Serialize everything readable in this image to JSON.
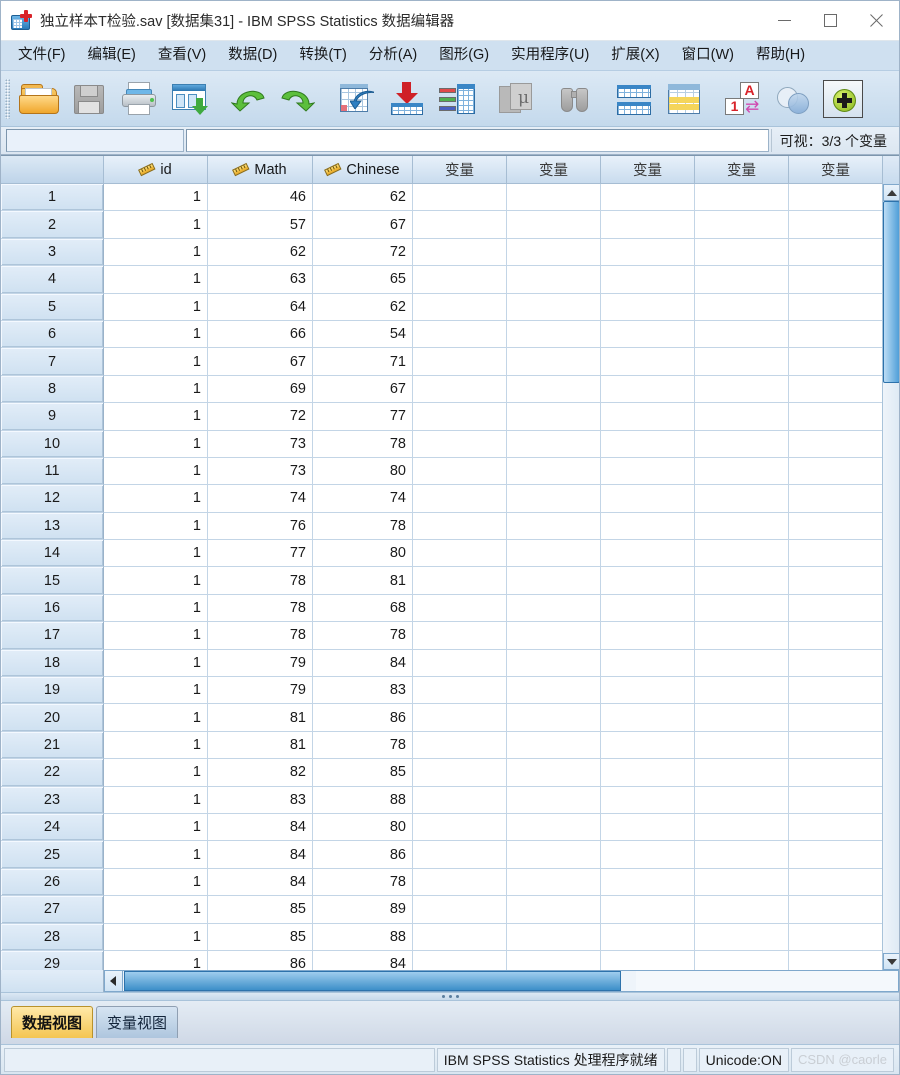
{
  "window": {
    "title": "独立样本T检验.sav [数据集31] - IBM SPSS Statistics 数据编辑器",
    "icon": "spss-data-editor-icon",
    "minimize_label": "—",
    "maximize_label": "□",
    "close_label": "✕"
  },
  "menu": [
    {
      "label": "文件(F)",
      "name": "menu-file"
    },
    {
      "label": "编辑(E)",
      "name": "menu-edit"
    },
    {
      "label": "查看(V)",
      "name": "menu-view"
    },
    {
      "label": "数据(D)",
      "name": "menu-data"
    },
    {
      "label": "转换(T)",
      "name": "menu-transform"
    },
    {
      "label": "分析(A)",
      "name": "menu-analyze"
    },
    {
      "label": "图形(G)",
      "name": "menu-graphs"
    },
    {
      "label": "实用程序(U)",
      "name": "menu-utilities"
    },
    {
      "label": "扩展(X)",
      "name": "menu-extensions"
    },
    {
      "label": "窗口(W)",
      "name": "menu-window"
    },
    {
      "label": "帮助(H)",
      "name": "menu-help"
    }
  ],
  "toolbar": [
    {
      "name": "open-file-icon"
    },
    {
      "name": "save-file-icon"
    },
    {
      "name": "print-icon"
    },
    {
      "name": "recall-dialogs-icon"
    },
    {
      "name": "undo-icon"
    },
    {
      "name": "redo-icon"
    },
    {
      "name": "goto-case-icon"
    },
    {
      "name": "goto-variable-icon"
    },
    {
      "name": "variables-icon"
    },
    {
      "name": "descriptive-statistics-icon"
    },
    {
      "name": "find-icon"
    },
    {
      "name": "split-file-icon"
    },
    {
      "name": "weight-cases-icon"
    },
    {
      "name": "value-labels-icon"
    },
    {
      "name": "use-subsets-icon"
    },
    {
      "name": "add-extension-icon"
    }
  ],
  "cellbar": {
    "cell_reference": "",
    "cell_value": "",
    "visible_vars": "可视：3/3 个变量"
  },
  "grid": {
    "columns": [
      {
        "label": "id",
        "measure_icon": "scale-ruler-icon",
        "named": true
      },
      {
        "label": "Math",
        "measure_icon": "scale-ruler-icon",
        "named": true
      },
      {
        "label": "Chinese",
        "measure_icon": "scale-ruler-icon",
        "named": true
      },
      {
        "label": "变量",
        "named": false
      },
      {
        "label": "变量",
        "named": false
      },
      {
        "label": "变量",
        "named": false
      },
      {
        "label": "变量",
        "named": false
      },
      {
        "label": "变量",
        "named": false
      }
    ],
    "rows": [
      {
        "n": "1",
        "id": "1",
        "math": "46",
        "chinese": "62"
      },
      {
        "n": "2",
        "id": "1",
        "math": "57",
        "chinese": "67"
      },
      {
        "n": "3",
        "id": "1",
        "math": "62",
        "chinese": "72"
      },
      {
        "n": "4",
        "id": "1",
        "math": "63",
        "chinese": "65"
      },
      {
        "n": "5",
        "id": "1",
        "math": "64",
        "chinese": "62"
      },
      {
        "n": "6",
        "id": "1",
        "math": "66",
        "chinese": "54"
      },
      {
        "n": "7",
        "id": "1",
        "math": "67",
        "chinese": "71"
      },
      {
        "n": "8",
        "id": "1",
        "math": "69",
        "chinese": "67"
      },
      {
        "n": "9",
        "id": "1",
        "math": "72",
        "chinese": "77"
      },
      {
        "n": "10",
        "id": "1",
        "math": "73",
        "chinese": "78"
      },
      {
        "n": "11",
        "id": "1",
        "math": "73",
        "chinese": "80"
      },
      {
        "n": "12",
        "id": "1",
        "math": "74",
        "chinese": "74"
      },
      {
        "n": "13",
        "id": "1",
        "math": "76",
        "chinese": "78"
      },
      {
        "n": "14",
        "id": "1",
        "math": "77",
        "chinese": "80"
      },
      {
        "n": "15",
        "id": "1",
        "math": "78",
        "chinese": "81"
      },
      {
        "n": "16",
        "id": "1",
        "math": "78",
        "chinese": "68"
      },
      {
        "n": "17",
        "id": "1",
        "math": "78",
        "chinese": "78"
      },
      {
        "n": "18",
        "id": "1",
        "math": "79",
        "chinese": "84"
      },
      {
        "n": "19",
        "id": "1",
        "math": "79",
        "chinese": "83"
      },
      {
        "n": "20",
        "id": "1",
        "math": "81",
        "chinese": "86"
      },
      {
        "n": "21",
        "id": "1",
        "math": "81",
        "chinese": "78"
      },
      {
        "n": "22",
        "id": "1",
        "math": "82",
        "chinese": "85"
      },
      {
        "n": "23",
        "id": "1",
        "math": "83",
        "chinese": "88"
      },
      {
        "n": "24",
        "id": "1",
        "math": "84",
        "chinese": "80"
      },
      {
        "n": "25",
        "id": "1",
        "math": "84",
        "chinese": "86"
      },
      {
        "n": "26",
        "id": "1",
        "math": "84",
        "chinese": "78"
      },
      {
        "n": "27",
        "id": "1",
        "math": "85",
        "chinese": "89"
      },
      {
        "n": "28",
        "id": "1",
        "math": "85",
        "chinese": "88"
      },
      {
        "n": "29",
        "id": "1",
        "math": "86",
        "chinese": "84"
      }
    ]
  },
  "tabs": [
    {
      "label": "数据视图",
      "name": "tab-data-view",
      "active": true
    },
    {
      "label": "变量视图",
      "name": "tab-variable-view",
      "active": false
    }
  ],
  "status": {
    "left": "",
    "processor": "IBM SPSS Statistics 处理程序就绪",
    "unicode": "Unicode:ON",
    "watermark": "CSDN @caorle"
  },
  "colors": {
    "menubar_bg": "#cfe0f0",
    "toolbar_bg": "#d3e2f0",
    "header_bg": "#cfe1f1",
    "active_tab": "#f4c552",
    "scrollbar": "#3d8fc9"
  }
}
